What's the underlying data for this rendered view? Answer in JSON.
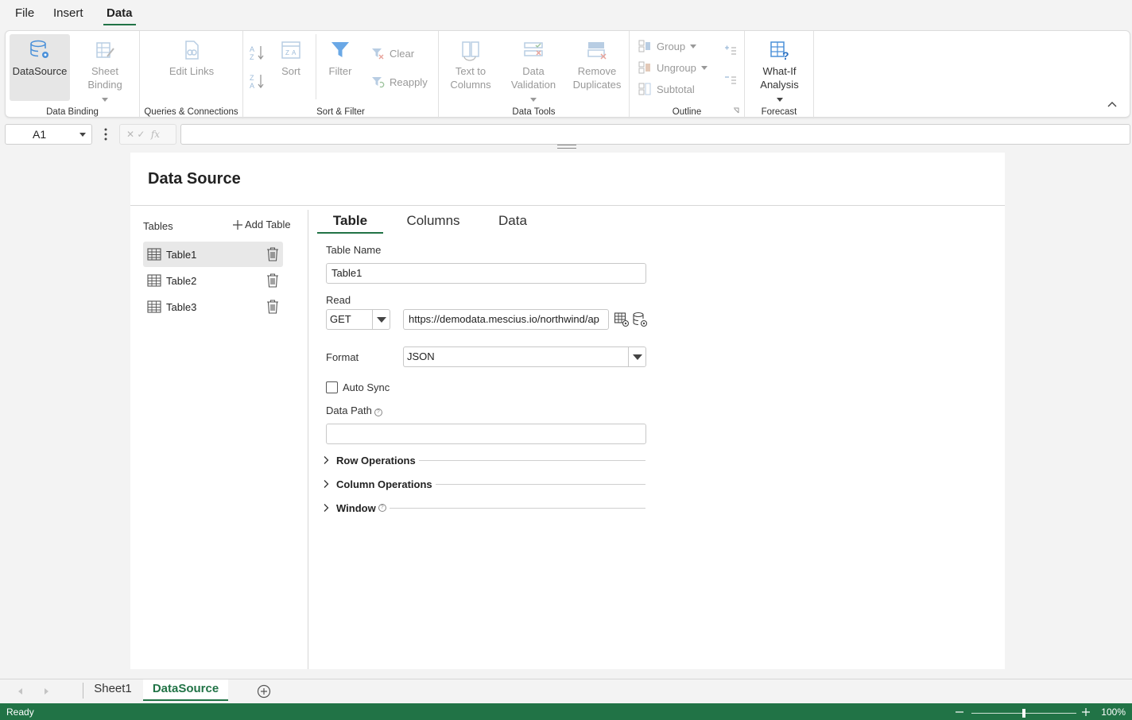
{
  "menu": {
    "tabs": [
      "File",
      "Insert",
      "Data"
    ],
    "active": "Data"
  },
  "ribbon": {
    "data_binding": {
      "label": "Data Binding",
      "datasource": "DataSource",
      "sheet_binding_1": "Sheet",
      "sheet_binding_2": "Binding"
    },
    "queries": {
      "label": "Queries & Connections",
      "edit_links": "Edit Links"
    },
    "sort_filter": {
      "label": "Sort & Filter",
      "sort": "Sort",
      "filter": "Filter",
      "clear": "Clear",
      "reapply": "Reapply"
    },
    "data_tools": {
      "label": "Data Tools",
      "text_to_columns_1": "Text to",
      "text_to_columns_2": "Columns",
      "data_validation_1": "Data",
      "data_validation_2": "Validation",
      "remove_duplicates_1": "Remove",
      "remove_duplicates_2": "Duplicates"
    },
    "outline": {
      "label": "Outline",
      "group": "Group",
      "ungroup": "Ungroup",
      "subtotal": "Subtotal"
    },
    "forecast": {
      "label": "Forecast",
      "whatif_1": "What-If",
      "whatif_2": "Analysis"
    }
  },
  "formula_bar": {
    "cell": "A1",
    "fx": "fx",
    "value": ""
  },
  "panel": {
    "title": "Data Source",
    "tables_label": "Tables",
    "add_table": "Add Table",
    "tables": [
      "Table1",
      "Table2",
      "Table3"
    ],
    "selected_table": "Table1",
    "tabs": [
      "Table",
      "Columns",
      "Data"
    ],
    "active_tab": "Table",
    "form": {
      "table_name_label": "Table Name",
      "table_name": "Table1",
      "read_label": "Read",
      "read_method": "GET",
      "read_url": "https://demodata.mescius.io/northwind/ap",
      "format_label": "Format",
      "format": "JSON",
      "auto_sync_label": "Auto Sync",
      "auto_sync": false,
      "data_path_label": "Data Path",
      "data_path": ""
    },
    "sections": [
      "Row Operations",
      "Column Operations",
      "Window"
    ]
  },
  "sheets": {
    "tabs": [
      "Sheet1",
      "DataSource"
    ],
    "active": "DataSource"
  },
  "status": {
    "text": "Ready",
    "zoom": "100%",
    "zoom_level": 1.0
  },
  "colors": {
    "accent": "#217346",
    "disabled_icon": "#a9c5e0",
    "filter_icon": "#4a90d9"
  }
}
